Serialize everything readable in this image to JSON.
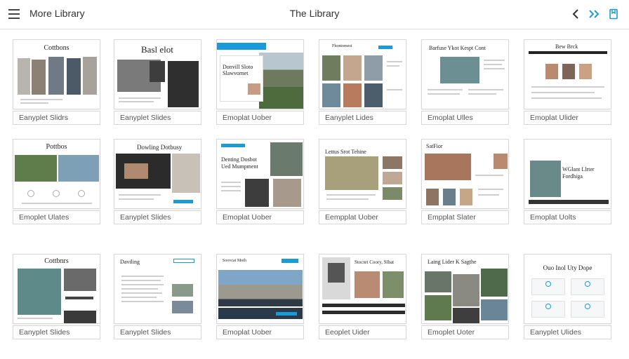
{
  "header": {
    "menu_icon": "hamburger-menu-icon",
    "nav_label": "More Library",
    "title": "The Library",
    "controls": [
      {
        "name": "back-icon"
      },
      {
        "name": "forward-double-icon"
      },
      {
        "name": "bookmark-icon"
      }
    ],
    "accent": "#1a9ad6"
  },
  "cards": [
    {
      "heading": "Cottbons",
      "caption": "Eanyplet Slidrs"
    },
    {
      "heading": "Basl elot",
      "caption": "Eanyplet Slides"
    },
    {
      "heading": "Donvill Sloto Slawvornet",
      "caption": "Emoplat Uober"
    },
    {
      "heading": "Fhontomest",
      "caption": "Eanyplet Lides"
    },
    {
      "heading": "Barfuse Ykot Kespt Cont",
      "caption": "Emoplat Ulles"
    },
    {
      "heading": "Bew Brck",
      "caption": "Emoplat Ulider"
    },
    {
      "heading": "Pottbos",
      "caption": "Emoplet Ulates"
    },
    {
      "heading": "Dowling Dotbusy",
      "caption": "Eanyplet Slides"
    },
    {
      "heading": "Denting Dosbot Ued Mumpment",
      "caption": "Emoplat Uober"
    },
    {
      "heading": "Lettus Srot Tehine",
      "caption": "Eempplat Uober"
    },
    {
      "heading": "SatFior",
      "caption": "Empplat Slater"
    },
    {
      "heading": "WGlant Llrter Fordhiga",
      "caption": "Emoplat Uolts"
    },
    {
      "heading": "Cottbnrs",
      "caption": "Eanyplet Slides"
    },
    {
      "heading": "Daviling",
      "caption": "Eanyplet Slides"
    },
    {
      "heading": "Soovcat Moth",
      "caption": "Emoplat Uober"
    },
    {
      "heading": "Stoctet Coory, Slbat",
      "caption": "Eeoplet Uider"
    },
    {
      "heading": "Laing Lider K Sagthe",
      "caption": "Emoplet Uoter"
    },
    {
      "heading": "Ouo Inol Uty Dope",
      "caption": "Eanyplet Ulides"
    }
  ]
}
